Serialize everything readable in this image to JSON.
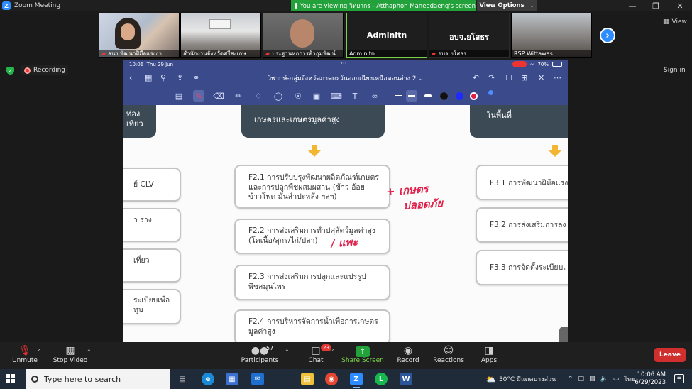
{
  "titlebar": {
    "app_title": "Zoom Meeting",
    "viewing_text": "You are viewing วิทยากร - Atthaphon Maneedaeng's screen",
    "view_options": "View Options"
  },
  "gallery": {
    "tiles": [
      {
        "name": "สนง.พัฒนาฝีมือแรงงา..."
      },
      {
        "name": "สำนักงานจังหวัดศรีสะเกษ"
      },
      {
        "name": "ประฐานหอการค้ากุมพัฒน์"
      },
      {
        "name": "Adminitn",
        "big": "Adminitn"
      },
      {
        "name": "อบจ.ยโสธร",
        "big": "อบจ.ยโสธร"
      },
      {
        "name": "RSP Wittawas"
      }
    ],
    "view_label": "View"
  },
  "status": {
    "recording": "Recording",
    "signin": "Sign in"
  },
  "ipad": {
    "time": "10:06",
    "date": "Thu 29 Jun",
    "battery": "70%"
  },
  "doc": {
    "title": "วิพากษ์-กลุ่มจังหวัดภาคตะวันออกเฉียงเหนือตอนล่าง 2"
  },
  "canvas": {
    "headers": [
      {
        "text": "ท่องเที่ยว"
      },
      {
        "text": "เกษตรและเกษตรมูลค่าสูง"
      },
      {
        "text": "ในพื้นที่"
      }
    ],
    "left_items": [
      "ย์ CLV",
      "า ราง",
      "เที่ยว",
      "ระเบียบเพื่อ\nทุน"
    ],
    "center_items": [
      "F2.1 การปรับปรุงพัฒนาผลิตภัณฑ์เกษตร\nและการปลูกพืชผสมผสาน (ข้าว อ้อย\nข้าวโพด มันสำปะหลัง ฯลฯ)",
      "F2.2 การส่งเสริมการทำปศุสัตว์มูลค่าสูง\n(โคเนื้อ/สุกร/ไก่/ปลา)",
      "F2.3 การส่งเสริมการปลูกและแปรรูป\nพืชสมุนไพร",
      "F2.4 การบริหารจัดการน้ำเพื่อการเกษตร\nมูลค่าสูง"
    ],
    "right_items": [
      "F3.1 การพัฒนาฝีมือแรง",
      "F3.2 การส่งเสริมการลง",
      "F3.3 การจัดตั้งระเบียบเ"
    ],
    "annotations": [
      "+ เกษตร",
      "ปลอดภัย",
      "/ แพะ"
    ]
  },
  "controls": {
    "unmute": "Unmute",
    "stop_video": "Stop Video",
    "participants": "Participants",
    "participants_count": "57",
    "chat": "Chat",
    "chat_badge": "23",
    "share_screen": "Share Screen",
    "record": "Record",
    "reactions": "Reactions",
    "apps": "Apps",
    "leave": "Leave"
  },
  "taskbar": {
    "search_placeholder": "Type here to search",
    "weather": "30°C  มีแดดบางส่วน",
    "lang": "ไทย",
    "time": "10:06 AM",
    "date": "6/29/2023"
  },
  "colors": {
    "zoom_blue": "#2d8cff",
    "viewing_green": "#23a13b",
    "leave_red": "#d12e2e",
    "header_box": "#3c4a55",
    "arrow_yellow": "#f2b632",
    "annotation_red": "#e0204a"
  }
}
